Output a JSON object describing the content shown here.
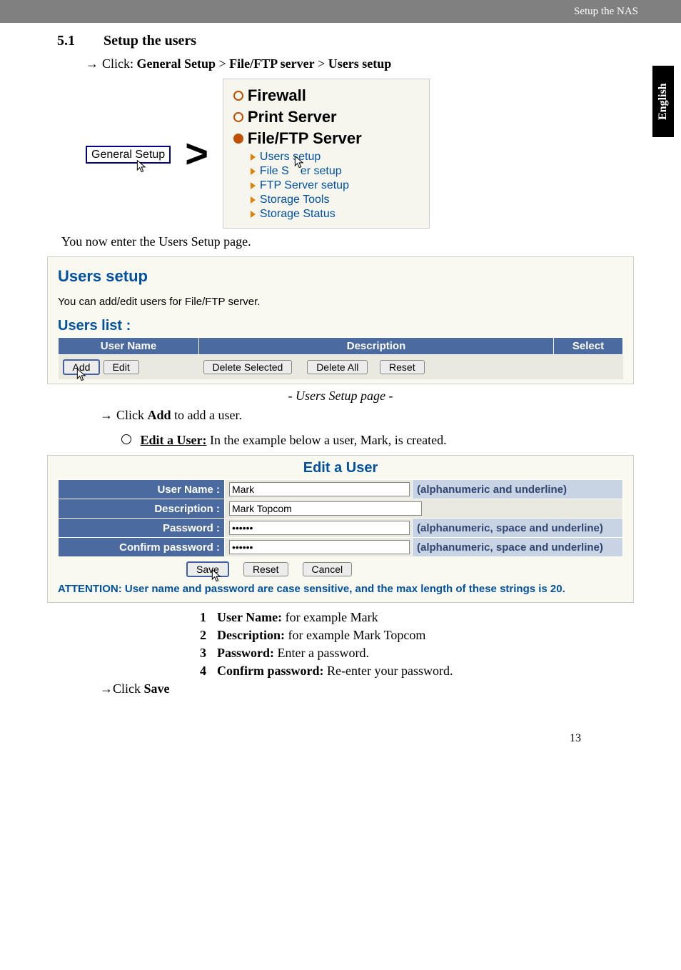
{
  "header": {
    "breadcrumb": "Setup the NAS",
    "side_tab": "English"
  },
  "section": {
    "number": "5.1",
    "title": "Setup the users"
  },
  "click_path": {
    "prefix": "Click:",
    "p1": "General Setup",
    "sep": ">",
    "p2": "File/FTP server",
    "p3": "Users setup"
  },
  "nav_figure": {
    "general_setup_btn": "General Setup",
    "menu": {
      "firewall": "Firewall",
      "print": "Print Server",
      "fileftp": "File/FTP Server",
      "sub": {
        "users": "Users setup",
        "fileserver_a": "File S",
        "fileserver_b": "er setup",
        "ftp": "FTP Server setup",
        "tools": "Storage Tools",
        "status": "Storage Status"
      }
    }
  },
  "enter_text": "You now enter the Users Setup page.",
  "users_setup": {
    "title": "Users setup",
    "desc": "You can add/edit users for File/FTP server.",
    "list_title": "Users list  :",
    "headers": {
      "user": "User Name",
      "desc": "Description",
      "select": "Select"
    },
    "buttons": {
      "add": "Add",
      "edit": "Edit",
      "del_sel": "Delete Selected",
      "del_all": "Delete All",
      "reset": "Reset"
    },
    "caption": "- Users Setup page -"
  },
  "add_instruction": {
    "prefix": "Click",
    "btn": "Add",
    "suffix": "to add a user."
  },
  "edit_user": {
    "heading": "Edit a User:",
    "intro": "In the example below a user, Mark, is created.",
    "form_title": "Edit a User",
    "labels": {
      "user": "User Name  :",
      "desc": "Description  :",
      "pass": "Password  :",
      "conf": "Confirm password  :"
    },
    "values": {
      "user": "Mark",
      "desc": "Mark Topcom",
      "pass": "••••••",
      "conf": "••••••"
    },
    "hints": {
      "user": "(alphanumeric and underline)",
      "pass": "(alphanumeric, space and underline)",
      "conf": "(alphanumeric, space and underline)"
    },
    "buttons": {
      "save": "Save",
      "reset": "Reset",
      "cancel": "Cancel"
    },
    "attention": "ATTENTION: User name and password are case sensitive, and the max length of these strings is 20."
  },
  "field_list": {
    "i1": {
      "n": "1",
      "b": "User Name:",
      "t": " for example Mark"
    },
    "i2": {
      "n": "2",
      "b": "Description:",
      "t": " for example Mark Topcom"
    },
    "i3": {
      "n": "3",
      "b": "Password:",
      "t": " Enter a password."
    },
    "i4": {
      "n": "4",
      "b": "Confirm password:",
      "t": " Re-enter your password."
    }
  },
  "save_instruction": {
    "prefix": "Click",
    "btn": "Save"
  },
  "page_number": "13"
}
